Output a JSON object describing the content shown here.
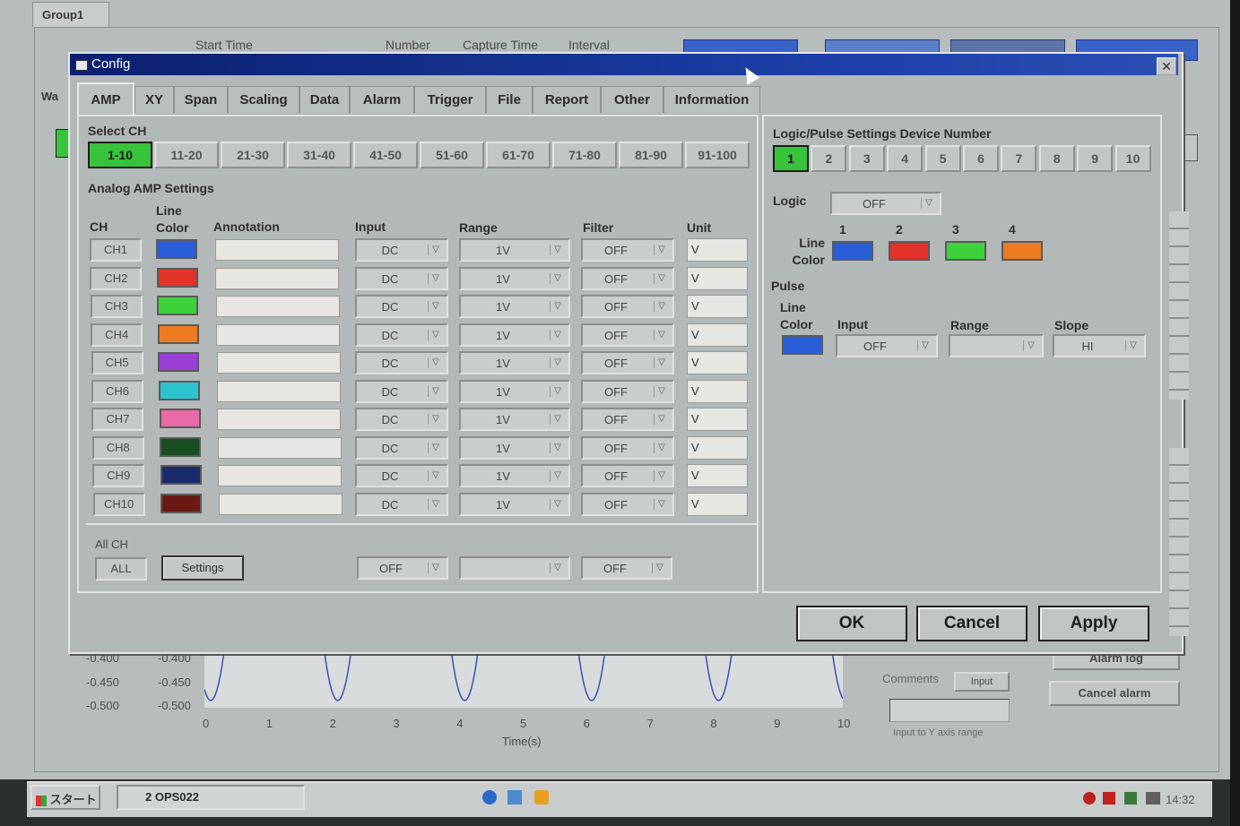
{
  "background_app": {
    "group_tab": "Group1",
    "headers": [
      "Start Time",
      "Number",
      "Capture Time",
      "Interval"
    ],
    "side_tab": "Wa",
    "plot": {
      "y_ticks_left": [
        "-0.400",
        "-0.450",
        "-0.500"
      ],
      "y_ticks_right": [
        "-0.400",
        "-0.450",
        "-0.500"
      ],
      "x_ticks": [
        "0",
        "1",
        "2",
        "3",
        "4",
        "5",
        "6",
        "7",
        "8",
        "9",
        "10"
      ],
      "x_label": "Time(s)"
    },
    "right_controls": {
      "comments_label": "Comments",
      "input_button": "Input",
      "input_hint": "Input to Y axis range",
      "alarm_log": "Alarm log",
      "cancel_alarm": "Cancel alarm"
    }
  },
  "taskbar": {
    "start_label": "スタート",
    "task_item": "2 OPS022",
    "clock": "14:32"
  },
  "dialog": {
    "title": "Config",
    "close_glyph": "✕",
    "tabs": [
      "AMP",
      "XY",
      "Span",
      "Scaling",
      "Data",
      "Alarm",
      "Trigger",
      "File",
      "Report",
      "Other",
      "Information"
    ],
    "active_tab": "AMP",
    "select_ch": {
      "label": "Select CH",
      "groups": [
        "1-10",
        "11-20",
        "21-30",
        "31-40",
        "41-50",
        "51-60",
        "61-70",
        "71-80",
        "81-90",
        "91-100"
      ],
      "selected": "1-10"
    },
    "analog": {
      "section_label": "Analog AMP Settings",
      "headers": {
        "ch": "CH",
        "line_color": "Line\nColor",
        "annotation": "Annotation",
        "input": "Input",
        "range": "Range",
        "filter": "Filter",
        "unit": "Unit"
      },
      "rows": [
        {
          "ch": "CH1",
          "color": "#2a5ed8",
          "input": "DC",
          "range": "1V",
          "filter": "OFF",
          "unit": "V"
        },
        {
          "ch": "CH2",
          "color": "#e2322a",
          "input": "DC",
          "range": "1V",
          "filter": "OFF",
          "unit": "V"
        },
        {
          "ch": "CH3",
          "color": "#3ed23a",
          "input": "DC",
          "range": "1V",
          "filter": "OFF",
          "unit": "V"
        },
        {
          "ch": "CH4",
          "color": "#ee7a22",
          "input": "DC",
          "range": "1V",
          "filter": "OFF",
          "unit": "V"
        },
        {
          "ch": "CH5",
          "color": "#9a3fd6",
          "input": "DC",
          "range": "1V",
          "filter": "OFF",
          "unit": "V"
        },
        {
          "ch": "CH6",
          "color": "#2cc3cf",
          "input": "DC",
          "range": "1V",
          "filter": "OFF",
          "unit": "V"
        },
        {
          "ch": "CH7",
          "color": "#e86aa6",
          "input": "DC",
          "range": "1V",
          "filter": "OFF",
          "unit": "V"
        },
        {
          "ch": "CH8",
          "color": "#1a4d22",
          "input": "DC",
          "range": "1V",
          "filter": "OFF",
          "unit": "V"
        },
        {
          "ch": "CH9",
          "color": "#1a2a6a",
          "input": "DC",
          "range": "1V",
          "filter": "OFF",
          "unit": "V"
        },
        {
          "ch": "CH10",
          "color": "#6a1a14",
          "input": "DC",
          "range": "1V",
          "filter": "OFF",
          "unit": "V"
        }
      ],
      "all_ch": {
        "label": "All CH",
        "all_button": "ALL",
        "settings_button": "Settings",
        "input": "OFF",
        "range": "",
        "filter": "OFF"
      }
    },
    "logic_pulse": {
      "section_label": "Logic/Pulse Settings Device Number",
      "devices": [
        "1",
        "2",
        "3",
        "4",
        "5",
        "6",
        "7",
        "8",
        "9",
        "10"
      ],
      "selected_device": "1",
      "logic_label": "Logic",
      "logic_value": "OFF",
      "line_color_label": "Line\nColor",
      "logic_colors": [
        {
          "num": "1",
          "color": "#2a5ed8"
        },
        {
          "num": "2",
          "color": "#e2322a"
        },
        {
          "num": "3",
          "color": "#3ed23a"
        },
        {
          "num": "4",
          "color": "#ee7a22"
        }
      ],
      "pulse_label": "Pulse",
      "pulse_line_color_label": "Line\nColor",
      "pulse_color": "#2a5ed8",
      "input_label": "Input",
      "input_value": "OFF",
      "range_label": "Range",
      "range_value": "",
      "slope_label": "Slope",
      "slope_value": "HI"
    },
    "buttons": {
      "ok": "OK",
      "cancel": "Cancel",
      "apply": "Apply"
    }
  }
}
